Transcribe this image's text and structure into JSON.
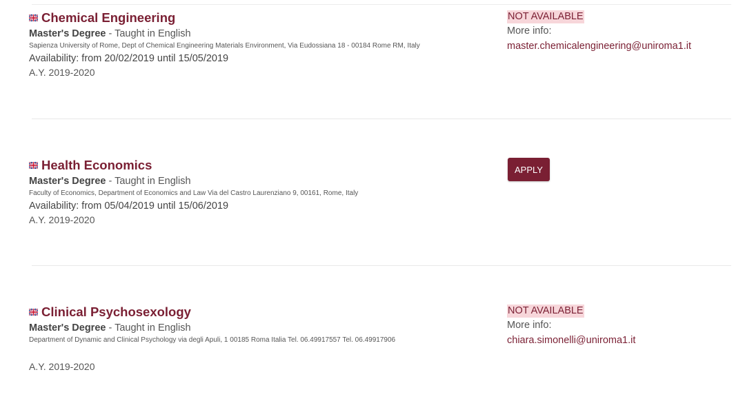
{
  "colors": {
    "brand": "#7a1f33",
    "not_available_bg": "#f7d6da"
  },
  "courses": [
    {
      "flag_icon": "uk-flag-icon",
      "title": "Chemical Engineering",
      "degree": "Master's Degree",
      "taught": " - Taught in English",
      "address": "Sapienza University of Rome, Dept of Chemical Engineering Materials Environment, Via Eudossiana 18 - 00184 Rome RM, Italy",
      "availability": "Availability: from 20/02/2019 until 15/05/2019",
      "academic_year": "A.Y. 2019-2020",
      "status": "NOT AVAILABLE",
      "more_info_label": "More info:",
      "contact_email": "master.chemicalengineering@uniroma1.it"
    },
    {
      "flag_icon": "uk-flag-icon",
      "title": "Health Economics",
      "degree": "Master's Degree",
      "taught": " - Taught in English",
      "address": "Faculty of Economics, Department of Economics and Law Via del Castro Laurenziano 9, 00161, Rome, Italy",
      "availability": "Availability: from 05/04/2019 until 15/06/2019",
      "academic_year": "A.Y. 2019-2020",
      "action_label": "APPLY"
    },
    {
      "flag_icon": "uk-flag-icon",
      "title": "Clinical Psychosexology",
      "degree": "Master's Degree",
      "taught": " - Taught in English",
      "address": "Department of Dynamic and Clinical Psychology via degli Apuli, 1 00185 Roma Italia Tel. 06.49917557 Tel. 06.49917906",
      "academic_year": "A.Y. 2019-2020",
      "status": "NOT AVAILABLE",
      "more_info_label": "More info:",
      "contact_email": "chiara.simonelli@uniroma1.it"
    }
  ]
}
